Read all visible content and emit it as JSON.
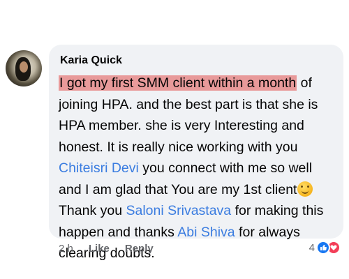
{
  "comment": {
    "author": "Karia Quick",
    "body": {
      "highlight": "I got my first SMM client within a month",
      "t1": " of joining HPA.  and the best part is that she is HPA member. she is very Interesting and honest. It is really nice working with you ",
      "mention1": "Chiteisri Devi",
      "t2": "  you connect with me so well and I am glad that You are my 1st client",
      "t3": " Thank you ",
      "mention2": "Saloni Srivastava",
      "t4": " for making this happen and thanks ",
      "mention3": "Abi Shiva",
      "t5": "  for always clearing doubts."
    },
    "emoji": "hugging-face-emoji",
    "mention_color": "#3a7ce0",
    "highlight_color": "#e89a9a"
  },
  "actions": {
    "time": "2 h",
    "like": "Like",
    "reply": "Reply"
  },
  "reactions": {
    "count": "4",
    "icons": [
      "like-icon",
      "love-icon"
    ],
    "like_color": "#1877f2",
    "love_color": "#f33e58"
  }
}
